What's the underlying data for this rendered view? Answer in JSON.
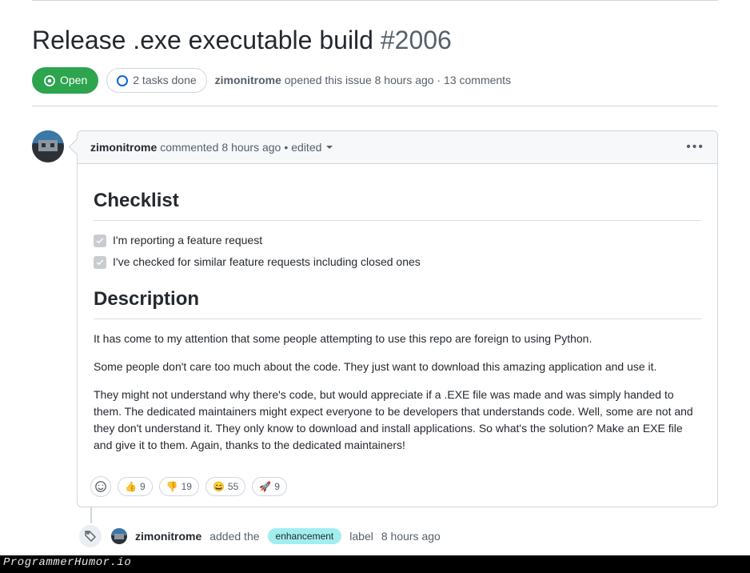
{
  "issue": {
    "title": "Release .exe executable build",
    "number": "#2006",
    "state": "Open",
    "tasks_done": "2 tasks done",
    "opened_by": "zimonitrome",
    "opened_action": "opened this issue",
    "opened_time": "8 hours ago",
    "comments_count": "13 comments"
  },
  "comment": {
    "author": "zimonitrome",
    "action": "commented",
    "time": "8 hours ago",
    "edited": "edited",
    "heading_checklist": "Checklist",
    "checklist": [
      "I'm reporting a feature request",
      "I've checked for similar feature requests including closed ones"
    ],
    "heading_description": "Description",
    "paragraphs": [
      "It has come to my attention that some people attempting to use this repo are foreign to using Python.",
      "Some people don't care too much about the code. They just want to download this amazing application and use it.",
      "They might not understand why there's code, but would appreciate if a .EXE file was made and was simply handed to them. The dedicated maintainers might expect everyone to be developers that understands code. Well, some are not and they don't understand it. They only know to download and install applications. So what's the solution? Make an EXE file and give it to them. Again, thanks to the dedicated maintainers!"
    ],
    "reactions": [
      {
        "emoji": "👍",
        "count": "9"
      },
      {
        "emoji": "👎",
        "count": "19"
      },
      {
        "emoji": "😄",
        "count": "55"
      },
      {
        "emoji": "🚀",
        "count": "9"
      }
    ]
  },
  "event": {
    "actor": "zimonitrome",
    "text_before": "added the",
    "label": "enhancement",
    "text_after": "label",
    "time": "8 hours ago"
  },
  "watermark": "ProgrammerHumor.io"
}
